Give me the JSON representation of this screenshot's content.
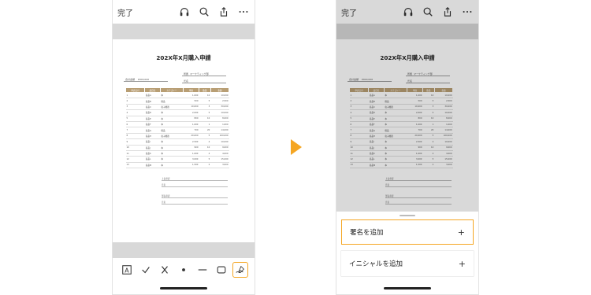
{
  "left_phone": {
    "done_label": "完了",
    "document": {
      "title": "202X年X月購入申請",
      "meta": {
        "dept_label": "所属",
        "dept_value": "マーケティング部",
        "name_label": "氏名",
        "total_label": "合計金額",
        "total_value": "¥000,000"
      },
      "table_headers": [
        "申請日付",
        "品目名",
        "カテゴリー",
        "単価",
        "数量",
        "金額"
      ],
      "rows": [
        [
          "1",
          "商品A",
          "本",
          "1,000",
          "10",
          "10,000"
        ],
        [
          "2",
          "商品B",
          "備品",
          "500",
          "5",
          "2,500"
        ],
        [
          "3",
          "商品C",
          "電子機器",
          "10,000",
          "3",
          "30,000"
        ],
        [
          "4",
          "商品D",
          "本",
          "2,000",
          "5",
          "10,000"
        ],
        [
          "5",
          "商品E",
          "本",
          "800",
          "10",
          "8,000"
        ],
        [
          "6",
          "商品F",
          "本",
          "1,000",
          "1",
          "1,000"
        ],
        [
          "7",
          "商品G",
          "備品",
          "700",
          "20",
          "14,000"
        ],
        [
          "8",
          "商品H",
          "電子機器",
          "20,000",
          "5",
          "100,000"
        ],
        [
          "9",
          "商品I",
          "本",
          "2,500",
          "4",
          "10,000"
        ],
        [
          "10",
          "商品J",
          "本",
          "900",
          "10",
          "9,000"
        ],
        [
          "11",
          "商品K",
          "本",
          "1,000",
          "4",
          "4,000"
        ],
        [
          "12",
          "商品L",
          "本",
          "3,000",
          "5",
          "15,000"
        ],
        [
          "13",
          "商品M",
          "本",
          "1,500",
          "2",
          "3,000"
        ]
      ],
      "signers": [
        {
          "role": "上長承認",
          "name_label": "氏名"
        },
        {
          "role": "部長承認",
          "name_label": "氏名"
        }
      ]
    },
    "toolbar": {
      "text_tool": "A"
    }
  },
  "right_phone": {
    "done_label": "完了",
    "options": {
      "add_signature": "署名を追加",
      "add_initials": "イニシャルを追加",
      "plus": "+"
    }
  },
  "icons": [
    "headphones-icon",
    "search-icon",
    "share-icon",
    "more-icon",
    "text-box-icon",
    "checkmark-icon",
    "cross-icon",
    "dot-icon",
    "line-icon",
    "rectangle-icon",
    "signature-pen-icon"
  ],
  "colors": {
    "accent_orange": "#f5a623",
    "table_header": "#b89e74",
    "gray_band": "#d8d8d8"
  }
}
